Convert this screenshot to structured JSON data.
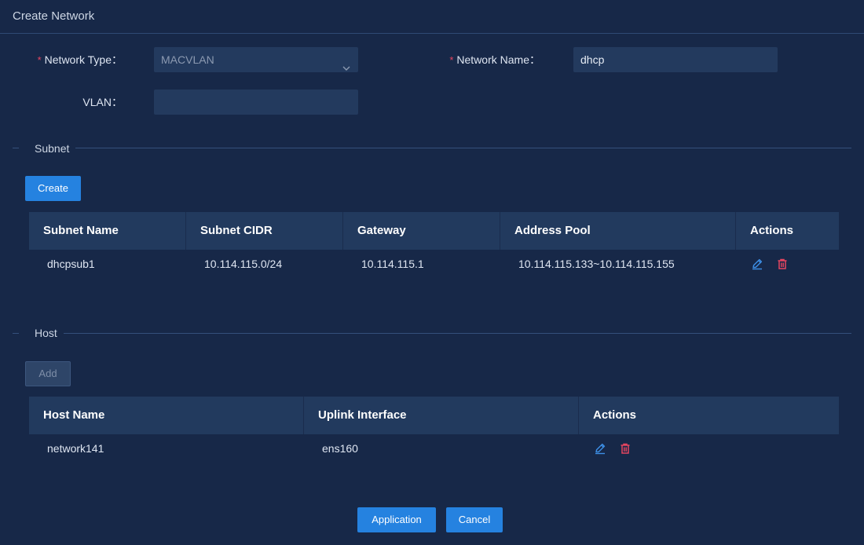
{
  "dialog": {
    "title": "Create Network"
  },
  "form": {
    "network_type": {
      "label": "Network Type：",
      "value": "MACVLAN"
    },
    "network_name": {
      "label": "Network Name：",
      "value": "dhcp"
    },
    "vlan": {
      "label": "VLAN：",
      "value": ""
    }
  },
  "subnet": {
    "section_title": "Subnet",
    "create_label": "Create",
    "columns": [
      "Subnet Name",
      "Subnet CIDR",
      "Gateway",
      "Address Pool",
      "Actions"
    ],
    "rows": [
      {
        "name": "dhcpsub1",
        "cidr": "10.114.115.0/24",
        "gateway": "10.114.115.1",
        "pool": "10.114.115.133~10.114.115.155"
      }
    ]
  },
  "host": {
    "section_title": "Host",
    "add_label": "Add",
    "columns": [
      "Host Name",
      "Uplink Interface",
      "Actions"
    ],
    "rows": [
      {
        "name": "network141",
        "uplink": "ens160"
      }
    ]
  },
  "footer": {
    "apply_label": "Application",
    "cancel_label": "Cancel"
  },
  "colors": {
    "background": "#172848",
    "primary": "#2582e0",
    "danger": "#e64560",
    "edit": "#3d8fe6"
  },
  "icons": {
    "edit": "pencil-icon",
    "delete": "trash-icon",
    "dropdown": "chevron-down-icon"
  }
}
